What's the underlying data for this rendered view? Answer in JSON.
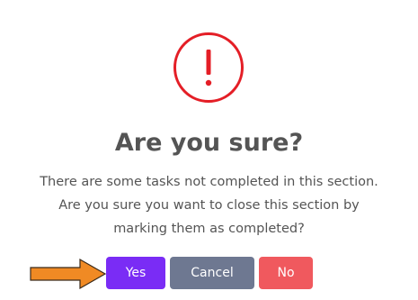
{
  "dialog": {
    "icon": "exclamation-circle-icon",
    "title": "Are you sure?",
    "message": "There are some tasks not completed in this section. Are you sure you want to close this section by marking them as completed?",
    "buttons": {
      "yes_label": "Yes",
      "cancel_label": "Cancel",
      "no_label": "No"
    }
  },
  "annotation": {
    "icon": "orange-arrow-icon"
  },
  "colors": {
    "warning": "#e41e26",
    "text": "#545454",
    "yes": "#7a2cf5",
    "cancel": "#6e7891",
    "no": "#f0595e",
    "arrow": "#f08a24"
  }
}
